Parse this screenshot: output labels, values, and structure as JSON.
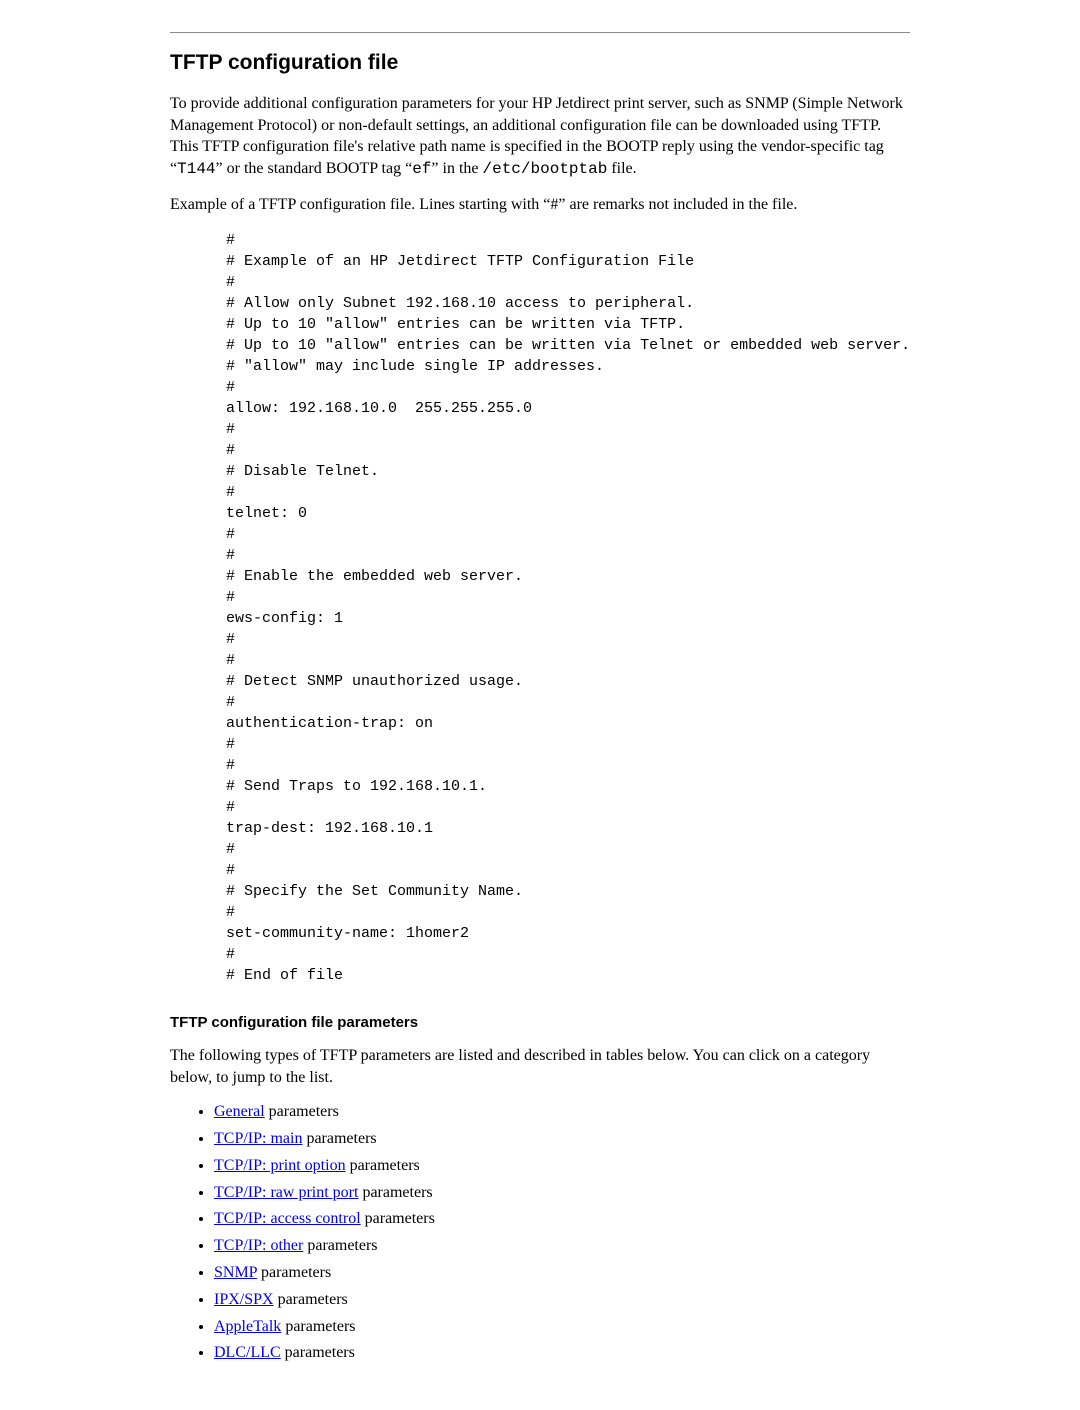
{
  "section_title": "TFTP configuration file",
  "intro_p1_a": "To provide additional configuration parameters for your HP Jetdirect print server, such as SNMP (Simple Network Management Protocol) or non-default settings, an additional configuration file can be downloaded using TFTP. This TFTP configuration file's relative path name is specified in the BOOTP reply using the vendor-specific tag “",
  "intro_code_t144": "T144",
  "intro_p1_b": "” or the standard BOOTP tag “",
  "intro_code_ef": "ef",
  "intro_p1_c": "” in the ",
  "intro_code_path": "/etc/bootptab",
  "intro_p1_d": " file.",
  "intro_p2": "Example of a TFTP configuration file. Lines starting with “#” are remarks not included in the file.",
  "code_block": "#\n# Example of an HP Jetdirect TFTP Configuration File\n#\n# Allow only Subnet 192.168.10 access to peripheral.\n# Up to 10 \"allow\" entries can be written via TFTP.\n# Up to 10 \"allow\" entries can be written via Telnet or embedded web server.\n# \"allow\" may include single IP addresses.\n#\nallow: 192.168.10.0  255.255.255.0\n#\n#\n# Disable Telnet.\n#\ntelnet: 0\n#\n#\n# Enable the embedded web server.\n#\news-config: 1\n#\n#\n# Detect SNMP unauthorized usage.\n#\nauthentication-trap: on\n#\n#\n# Send Traps to 192.168.10.1.\n#\ntrap-dest: 192.168.10.1\n#\n#\n# Specify the Set Community Name.\n#\nset-community-name: 1homer2\n#\n# End of file",
  "sub_title": "TFTP configuration file parameters",
  "sub_intro": "The following types of TFTP parameters are listed and described in tables below. You can click on a category below, to jump to the list.",
  "list": [
    {
      "link": "General",
      "suffix": " parameters"
    },
    {
      "link": "TCP/IP: main",
      "suffix": " parameters"
    },
    {
      "link": "TCP/IP: print option",
      "suffix": " parameters"
    },
    {
      "link": "TCP/IP: raw print port",
      "suffix": " parameters"
    },
    {
      "link": "TCP/IP: access control",
      "suffix": " parameters"
    },
    {
      "link": "TCP/IP: other",
      "suffix": " parameters"
    },
    {
      "link": "SNMP",
      "suffix": " parameters"
    },
    {
      "link": "IPX/SPX",
      "suffix": " parameters"
    },
    {
      "link": "AppleTalk",
      "suffix": " parameters"
    },
    {
      "link": "DLC/LLC",
      "suffix": " parameters"
    }
  ]
}
